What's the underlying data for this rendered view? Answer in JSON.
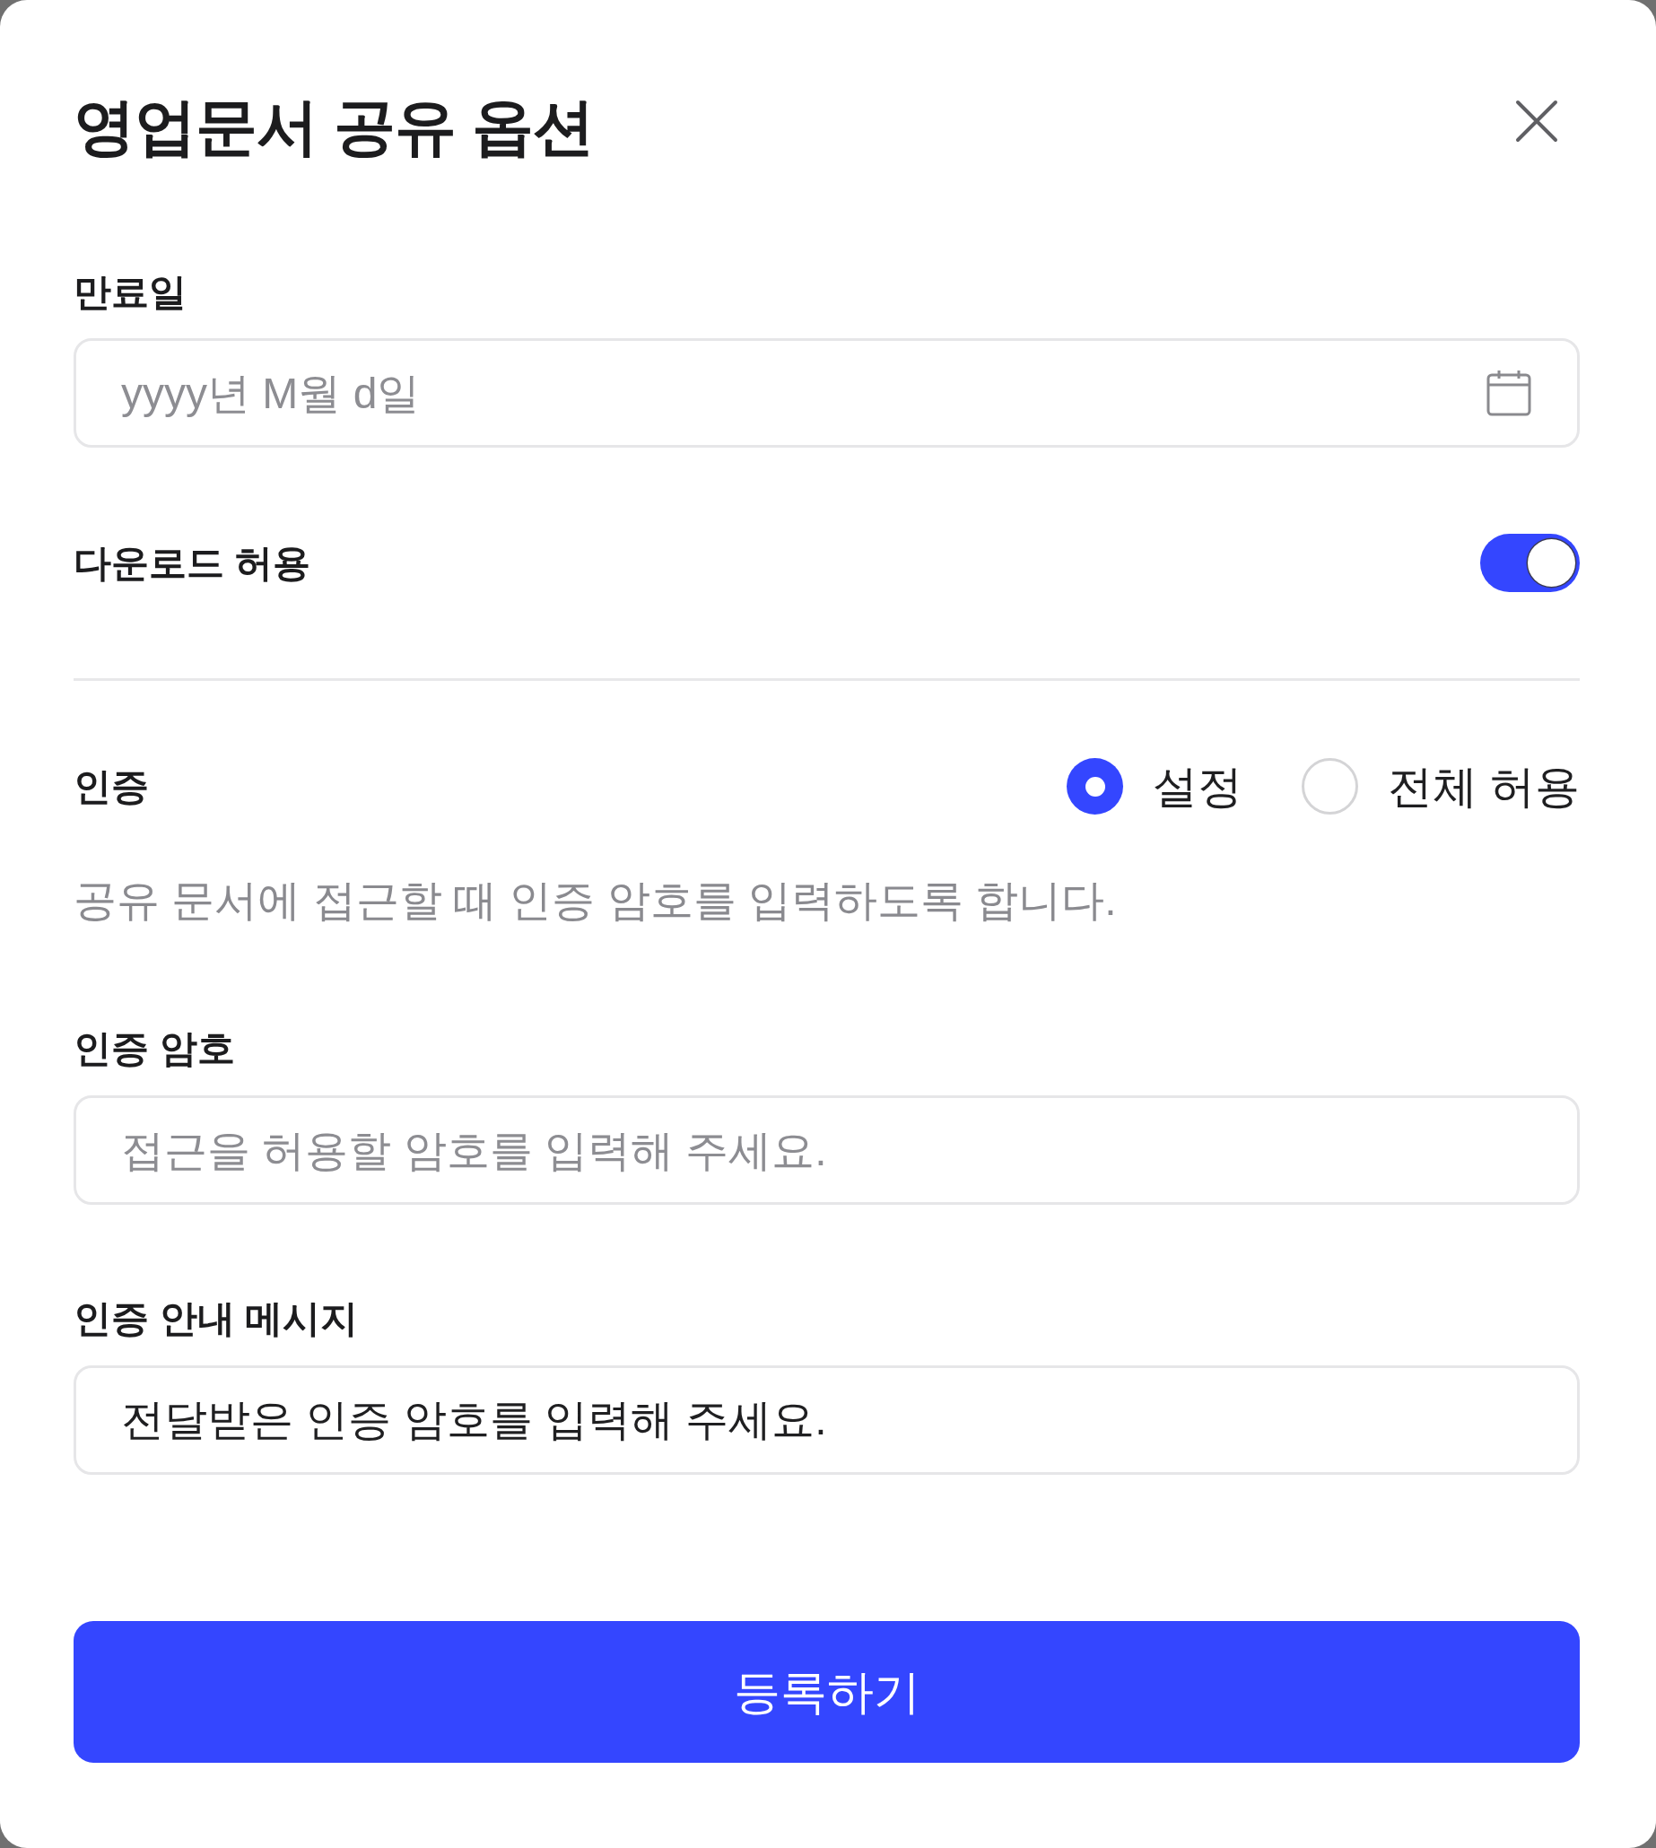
{
  "dialog": {
    "title": "영업문서 공유 옵션"
  },
  "expiry": {
    "label": "만료일",
    "placeholder": "yyyy년 M월 d일"
  },
  "download": {
    "label": "다운로드 허용",
    "on": true
  },
  "auth": {
    "label": "인증",
    "options": [
      {
        "label": "설정",
        "selected": true
      },
      {
        "label": "전체 허용",
        "selected": false
      }
    ],
    "description": "공유 문서에 접근할 때 인증 암호를 입력하도록 합니다."
  },
  "password": {
    "label": "인증 암호",
    "placeholder": "접근을 허용할 암호를 입력해 주세요."
  },
  "message": {
    "label": "인증 안내 메시지",
    "value": "전달받은 인증 암호를 입력해 주세요."
  },
  "submit": {
    "label": "등록하기"
  }
}
